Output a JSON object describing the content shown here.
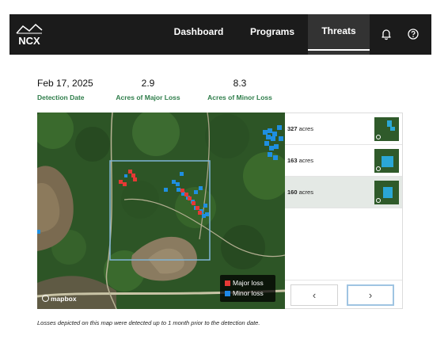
{
  "nav": {
    "logo_text": "NCX",
    "items": [
      {
        "label": "Dashboard"
      },
      {
        "label": "Programs"
      },
      {
        "label": "Threats",
        "active": true
      }
    ],
    "icons": [
      "bell-icon",
      "help-icon"
    ]
  },
  "stats": [
    {
      "value": "Feb 17, 2025",
      "label": "Detection Date"
    },
    {
      "value": "2.9",
      "label": "Acres of Major Loss"
    },
    {
      "value": "8.3",
      "label": "Acres of Minor Loss"
    }
  ],
  "legend": {
    "major": {
      "label": "Major loss",
      "color": "#e53935"
    },
    "minor": {
      "label": "Minor loss",
      "color": "#1e88e5"
    }
  },
  "map": {
    "attribution": "mapbox"
  },
  "list": [
    {
      "acres": "327",
      "unit": "acres"
    },
    {
      "acres": "163",
      "unit": "acres"
    },
    {
      "acres": "160",
      "unit": "acres",
      "selected": true
    }
  ],
  "pager": {
    "prev": "‹",
    "next": "›"
  },
  "footnote": "Losses depicted on this map were detected up to 1 month prior to the detection date."
}
